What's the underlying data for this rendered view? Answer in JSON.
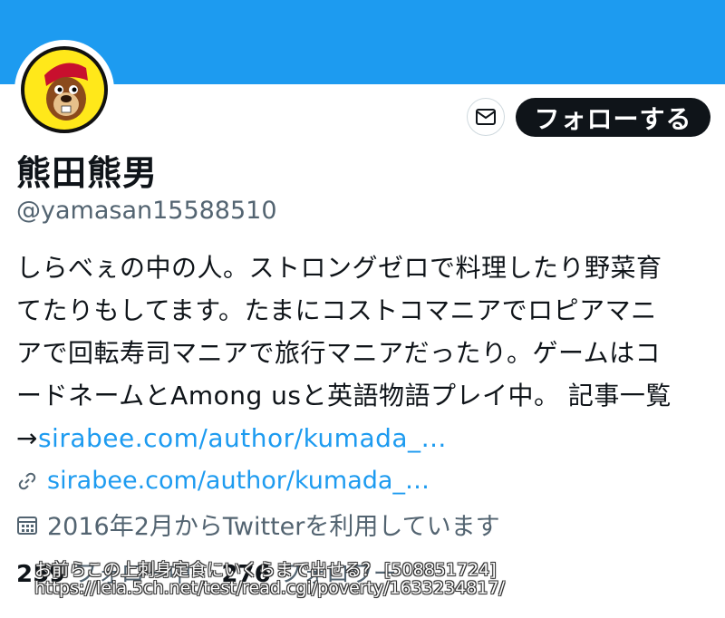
{
  "colors": {
    "banner": "#1d9bf0",
    "link": "#1d9bf0",
    "follow_bg": "#0f1419"
  },
  "profile": {
    "name": "熊田熊男",
    "handle": "@yamasan15588510",
    "bio_lines": [
      "しらべぇの中の人。ストロングゼロで料理したり野菜育",
      "てたりもしてます。たまにコストコマニアでロピアマニ",
      "アで回転寿司マニアで旅行マニアだったり。ゲームはコ",
      "ードネームとAmong usと英語物語プレイ中。 記事一覧"
    ],
    "bio_arrow": "→",
    "bio_link": "sirabee.com/author/kumada_…",
    "url": "sirabee.com/author/kumada_…",
    "joined": "2016年2月からTwitterを利用しています",
    "following_count": "259",
    "following_label": "フォロー中",
    "followers_count": "276",
    "followers_label": "フォロワー"
  },
  "actions": {
    "follow_label": "フォローする",
    "message_icon": "mail-icon"
  },
  "overlay": {
    "line1": "お前らこの上刺身定食にいくらまで出せる？ [508851724]",
    "line2": "https://leia.5ch.net/test/read.cgi/poverty/1633234817/"
  }
}
